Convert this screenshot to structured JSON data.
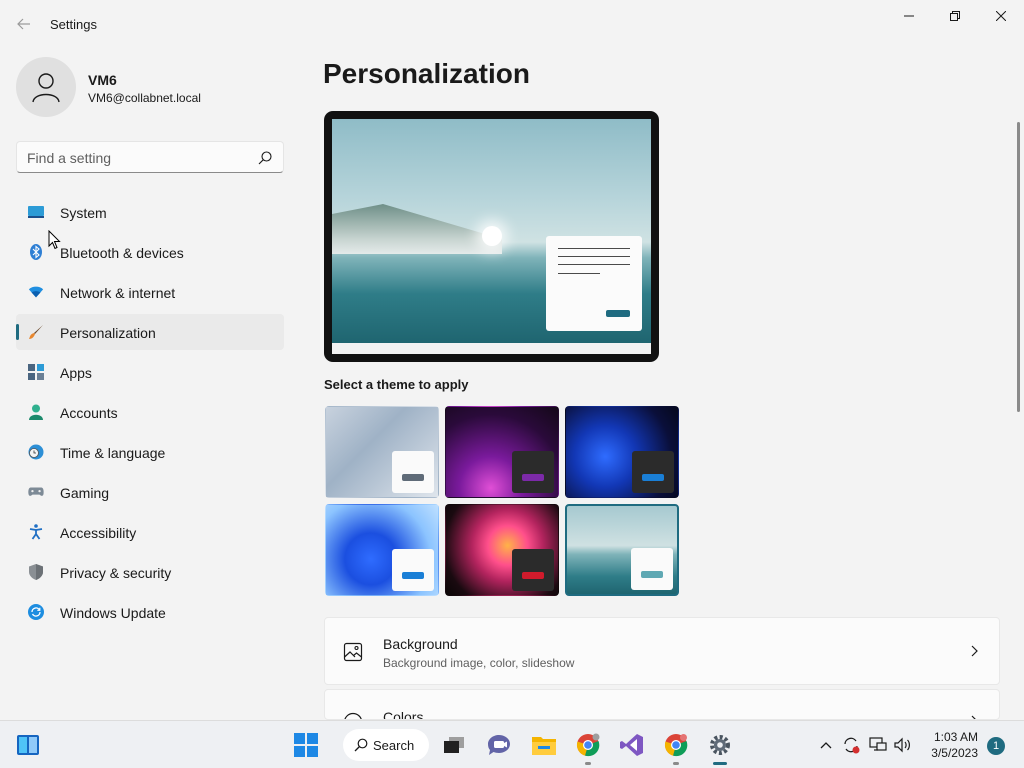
{
  "window": {
    "title": "Settings"
  },
  "user": {
    "name": "VM6",
    "email": "VM6@collabnet.local"
  },
  "search": {
    "placeholder": "Find a setting"
  },
  "sidebar": {
    "items": [
      {
        "label": "System",
        "icon": "system-icon",
        "selected": false
      },
      {
        "label": "Bluetooth & devices",
        "icon": "bluetooth-icon",
        "selected": false
      },
      {
        "label": "Network & internet",
        "icon": "wifi-icon",
        "selected": false
      },
      {
        "label": "Personalization",
        "icon": "brush-icon",
        "selected": true
      },
      {
        "label": "Apps",
        "icon": "apps-icon",
        "selected": false
      },
      {
        "label": "Accounts",
        "icon": "person-icon",
        "selected": false
      },
      {
        "label": "Time & language",
        "icon": "clock-globe-icon",
        "selected": false
      },
      {
        "label": "Gaming",
        "icon": "gamepad-icon",
        "selected": false
      },
      {
        "label": "Accessibility",
        "icon": "accessibility-icon",
        "selected": false
      },
      {
        "label": "Privacy & security",
        "icon": "shield-icon",
        "selected": false
      },
      {
        "label": "Windows Update",
        "icon": "update-icon",
        "selected": false
      }
    ]
  },
  "main": {
    "title": "Personalization",
    "theme_heading": "Select a theme to apply",
    "themes": [
      {
        "name": "windows-light-bloom",
        "selected": false
      },
      {
        "name": "windows-glow",
        "selected": false
      },
      {
        "name": "windows-dark-bloom",
        "selected": false
      },
      {
        "name": "windows-light-blue-bloom",
        "selected": false
      },
      {
        "name": "windows-captured-motion",
        "selected": false
      },
      {
        "name": "windows-lake",
        "selected": true
      }
    ],
    "settings": [
      {
        "title": "Background",
        "subtitle": "Background image, color, slideshow",
        "icon": "image-icon"
      },
      {
        "title": "Colors",
        "subtitle": "",
        "icon": "palette-icon"
      }
    ]
  },
  "taskbar": {
    "search_label": "Search",
    "time": "1:03 AM",
    "date": "3/5/2023",
    "notifications": "1"
  },
  "colors": {
    "accent": "#1f6b80",
    "background": "#f3f3f3"
  }
}
